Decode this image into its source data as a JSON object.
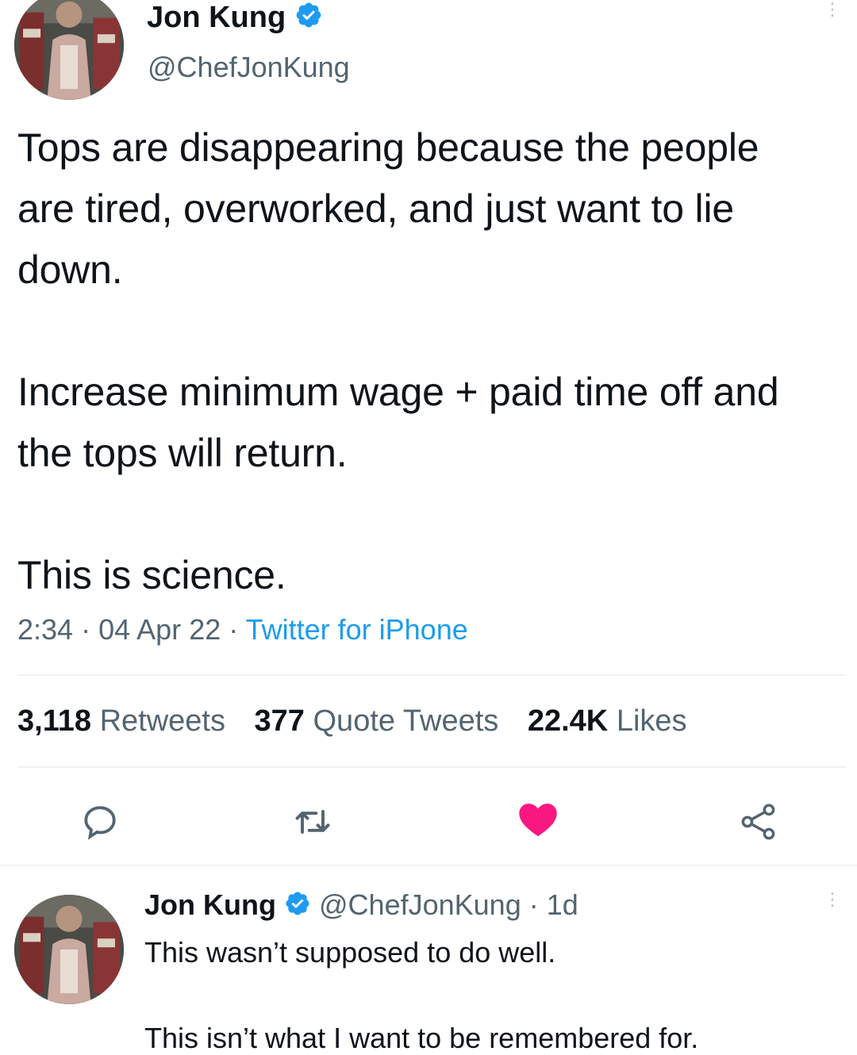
{
  "tweet": {
    "author": {
      "name": "Jon Kung",
      "handle": "@ChefJonKung",
      "verified": true,
      "avatar": "profile-photo"
    },
    "paragraphs": [
      "Tops are disappearing because the people are tired, overworked, and just want to lie down.",
      "Increase minimum wage + paid time off and the tops will return.",
      "This is science."
    ],
    "time": "2:34",
    "date": "04 Apr 22",
    "separator": "·",
    "source": "Twitter for iPhone",
    "stats": {
      "retweets": {
        "count": "3,118",
        "label": "Retweets"
      },
      "quotes": {
        "count": "377",
        "label": "Quote Tweets"
      },
      "likes": {
        "count": "22.4K",
        "label": "Likes"
      }
    },
    "actions": [
      {
        "name": "reply",
        "icon": "reply-icon"
      },
      {
        "name": "retweet",
        "icon": "retweet-icon"
      },
      {
        "name": "like",
        "icon": "heart-icon",
        "active": true
      },
      {
        "name": "share",
        "icon": "share-icon"
      }
    ]
  },
  "reply": {
    "author": {
      "name": "Jon Kung",
      "handle": "@ChefJonKung",
      "verified": true
    },
    "separator": "·",
    "time_ago": "1d",
    "lines": [
      "This wasn’t supposed to do well.",
      "This isn’t what I want to be remembered for."
    ]
  },
  "colors": {
    "text": "#0f1419",
    "secondary": "#536471",
    "link": "#1d9bf0",
    "verified": "#1d9bf0",
    "like": "#f91880",
    "divider": "#eff3f4"
  }
}
